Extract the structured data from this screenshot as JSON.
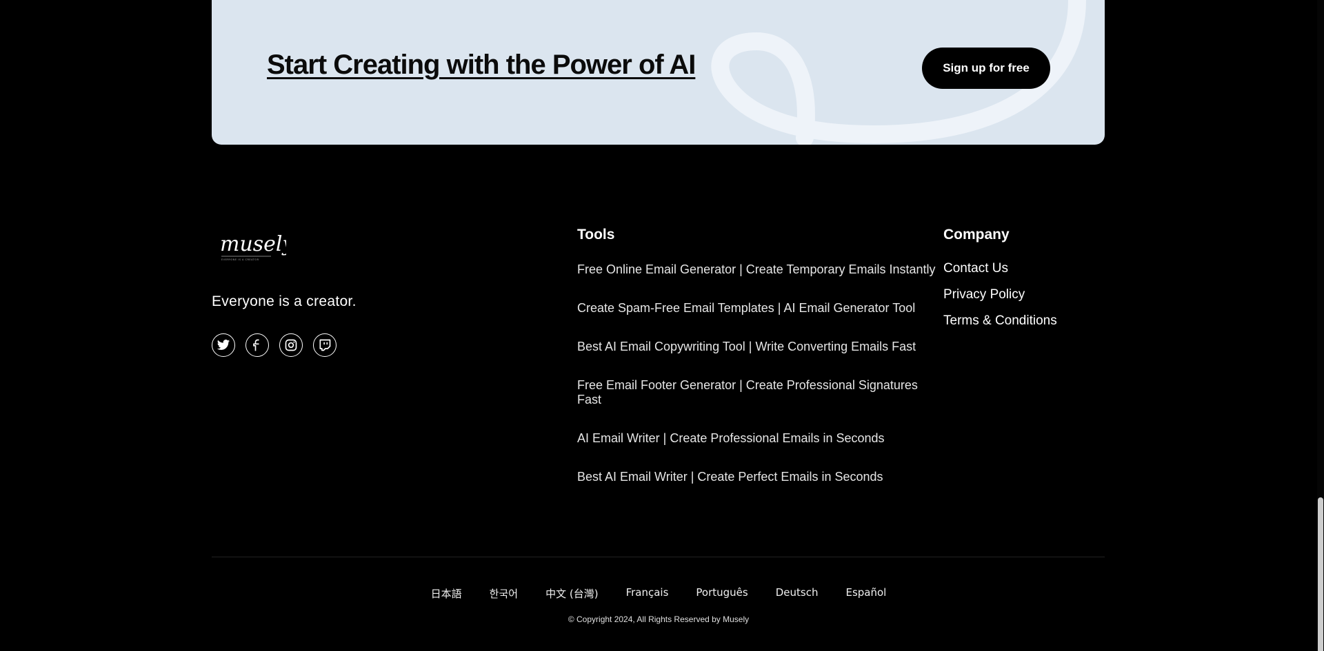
{
  "cta": {
    "title": "Start Creating with the Power of AI",
    "button_label": "Sign up for free"
  },
  "brand": {
    "logo_text": "musely",
    "logo_subtext": "EVERYONE IS A CREATOR",
    "tagline": "Everyone is a creator."
  },
  "socials": [
    {
      "name": "twitter-icon"
    },
    {
      "name": "facebook-icon"
    },
    {
      "name": "instagram-icon"
    },
    {
      "name": "twitch-icon"
    }
  ],
  "tools": {
    "heading": "Tools",
    "items": [
      {
        "label": "Free Online Email Generator | Create Temporary Emails Instantly"
      },
      {
        "label": "Create Spam-Free Email Templates | AI Email Generator Tool"
      },
      {
        "label": "Best AI Email Copywriting Tool | Write Converting Emails Fast"
      },
      {
        "label": "Free Email Footer Generator | Create Professional Signatures Fast"
      },
      {
        "label": "AI Email Writer | Create Professional Emails in Seconds"
      },
      {
        "label": "Best AI Email Writer | Create Perfect Emails in Seconds"
      }
    ]
  },
  "company": {
    "heading": "Company",
    "items": [
      {
        "label": "Contact Us"
      },
      {
        "label": "Privacy Policy"
      },
      {
        "label": "Terms & Conditions"
      }
    ]
  },
  "languages": [
    {
      "label": "日本語"
    },
    {
      "label": "한국어"
    },
    {
      "label": "中文 (台灣)"
    },
    {
      "label": "Français"
    },
    {
      "label": "Português"
    },
    {
      "label": "Deutsch"
    },
    {
      "label": "Español"
    }
  ],
  "footer": {
    "copyright": "© Copyright 2024, All Rights Reserved by Musely"
  },
  "colors": {
    "background": "#000000",
    "cta_background": "#dbe5ef",
    "cta_decoration": "#eef3f9",
    "button": "#000000"
  }
}
